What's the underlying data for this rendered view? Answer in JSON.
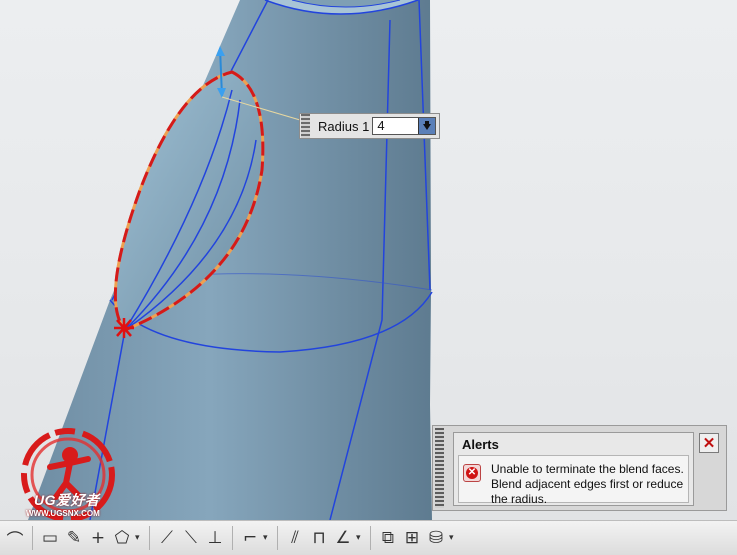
{
  "radius_input": {
    "label": "Radius 1",
    "value": "4"
  },
  "alerts": {
    "title": "Alerts",
    "message": "Unable to terminate the blend faces. Blend adjacent edges first or reduce the radius."
  },
  "watermark": {
    "brand": "UG爱好者",
    "url": "WWW.UGSNX.COM"
  },
  "toolbar": {
    "icons": [
      "corner-icon",
      "rectangle-icon",
      "pencil-icon",
      "plus-icon",
      "offset-curve-icon",
      "trim-icon",
      "extend-icon",
      "split-icon",
      "fillet-icon",
      "mirror-icon",
      "pattern-icon",
      "constraint-icon",
      "move-icon",
      "measure-icon",
      "analysis-icon"
    ]
  },
  "colors": {
    "model": "#7d9bb0",
    "edges": "#2244dd",
    "selection": "#d41a1a",
    "highlight": "#f0a050",
    "accent": "#5a7fb8"
  }
}
